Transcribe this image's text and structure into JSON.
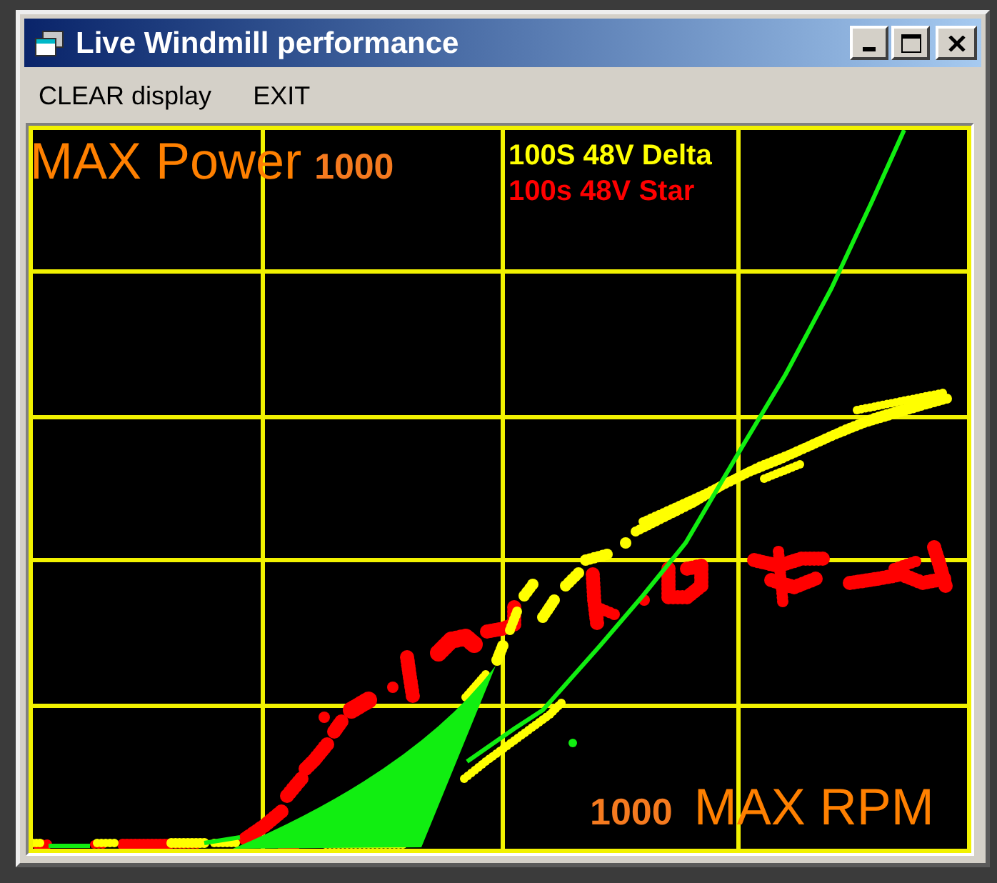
{
  "window": {
    "title": "Live Windmill performance"
  },
  "menu": [
    "CLEAR display",
    "EXIT"
  ],
  "plot": {
    "y_axis": {
      "label": "MAX Power",
      "max": "1000"
    },
    "legend": [
      {
        "label": "100S 48V Delta",
        "color": "#ffff00"
      },
      {
        "label": "100s 48V Star",
        "color": "#ff0000"
      }
    ],
    "x_axis": {
      "max": "1000",
      "label": "MAX RPM"
    }
  }
}
